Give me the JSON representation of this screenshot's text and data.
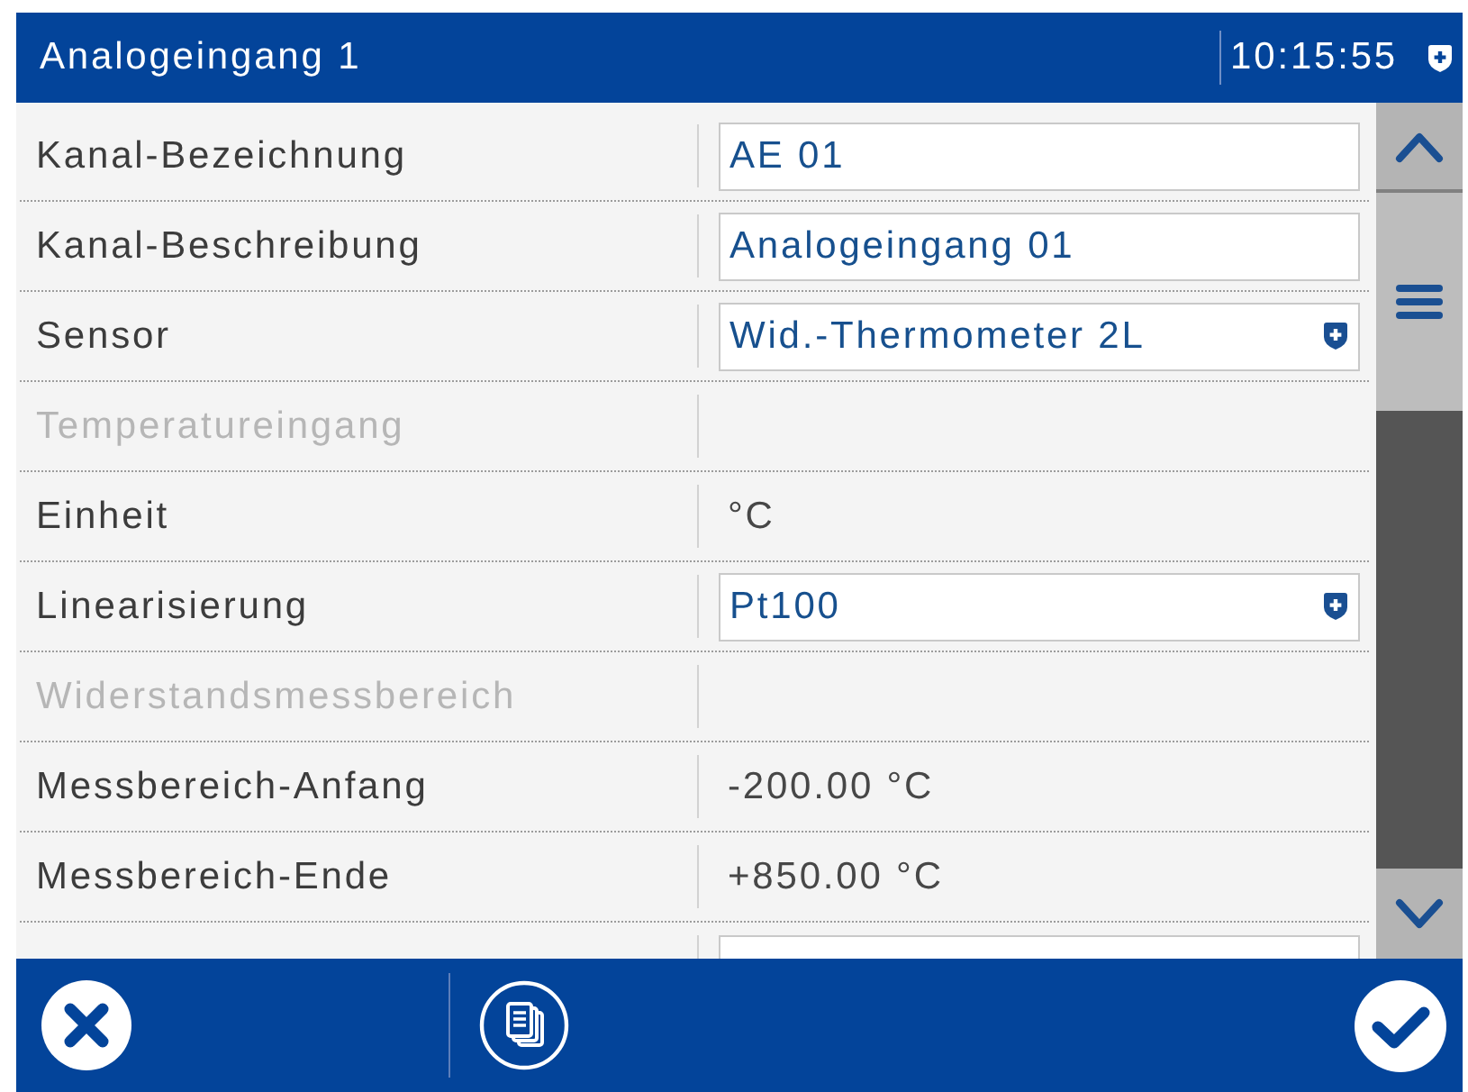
{
  "title_bar": {
    "title": "Analogeingang 1",
    "time": "10:15:55"
  },
  "rows": [
    {
      "kind": "input",
      "label": "Kanal-Bezeichnung",
      "value": "AE 01"
    },
    {
      "kind": "input",
      "label": "Kanal-Beschreibung",
      "value": "Analogeingang 01"
    },
    {
      "kind": "select",
      "label": "Sensor",
      "value": "Wid.-Thermometer 2L"
    },
    {
      "kind": "section",
      "label": "Temperatureingang"
    },
    {
      "kind": "text",
      "label": "Einheit",
      "value": "°C"
    },
    {
      "kind": "select",
      "label": "Linearisierung",
      "value": "Pt100"
    },
    {
      "kind": "section",
      "label": "Widerstandsmessbereich"
    },
    {
      "kind": "text",
      "label": "Messbereich-Anfang",
      "value": "-200.00 °C"
    },
    {
      "kind": "text",
      "label": "Messbereich-Ende",
      "value": "+850.00 °C"
    },
    {
      "kind": "cut"
    }
  ]
}
